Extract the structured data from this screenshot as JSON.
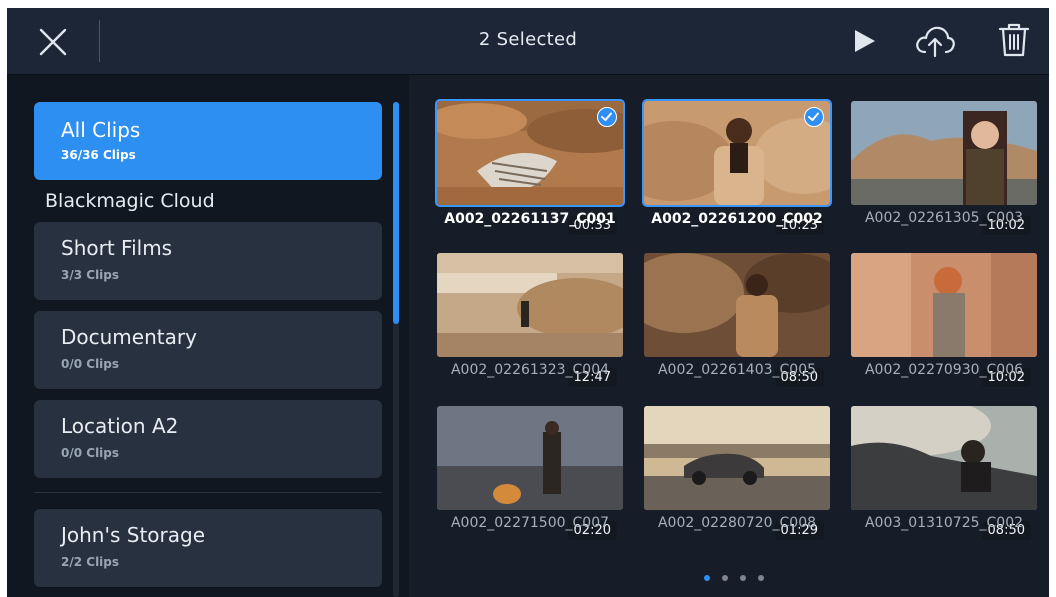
{
  "header": {
    "title": "2 Selected",
    "close_icon": "close-icon",
    "play_icon": "play-icon",
    "cloud_icon": "cloud-upload-icon",
    "trash_icon": "trash-icon"
  },
  "sidebar": {
    "all_clips": {
      "name": "All Clips",
      "count": "36/36 Clips"
    },
    "section_label": "Blackmagic Cloud",
    "items": [
      {
        "name": "Short Films",
        "count": "3/3 Clips"
      },
      {
        "name": "Documentary",
        "count": "0/0 Clips"
      },
      {
        "name": "Location A2",
        "count": "0/0 Clips"
      },
      {
        "name": "John's Storage",
        "count": "2/2 Clips"
      }
    ]
  },
  "clips": [
    {
      "name": "A002_02261137_C001",
      "duration": "00:33",
      "selected": true
    },
    {
      "name": "A002_02261200_C002",
      "duration": "10:23",
      "selected": true
    },
    {
      "name": "A002_02261305_C003",
      "duration": "10:02",
      "selected": false
    },
    {
      "name": "A002_02261323_C004",
      "duration": "12:47",
      "selected": false
    },
    {
      "name": "A002_02261403_C005",
      "duration": "08:50",
      "selected": false
    },
    {
      "name": "A002_02270930_C006",
      "duration": "10:02",
      "selected": false
    },
    {
      "name": "A002_02271500_C007",
      "duration": "02:20",
      "selected": false
    },
    {
      "name": "A002_02280720_C008",
      "duration": "01:29",
      "selected": false
    },
    {
      "name": "A003_01310725_C002",
      "duration": "08:50",
      "selected": false
    }
  ],
  "pagination": {
    "pages": 4,
    "current": 1
  },
  "colors": {
    "accent": "#2e8ff3",
    "background": "#141b25",
    "topbar": "#1d2637"
  }
}
